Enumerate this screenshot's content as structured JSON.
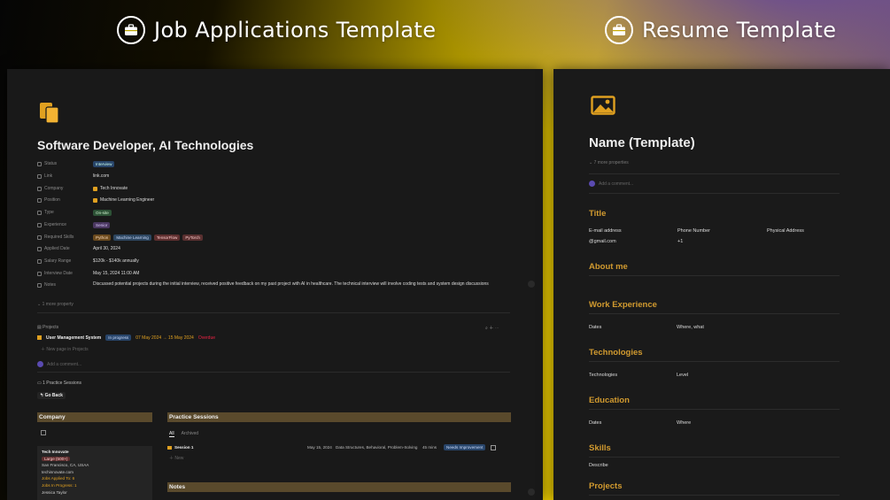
{
  "headers": {
    "left": "Job Applications Template",
    "right": "Resume Template"
  },
  "job": {
    "title": "Software Developer, AI Technologies",
    "props": [
      {
        "k": "Status",
        "v": "Interview"
      },
      {
        "k": "Link",
        "v": "link.com"
      },
      {
        "k": "Company",
        "v": "Tech Innovate"
      },
      {
        "k": "Position",
        "v": "Machine Learning Engineer"
      },
      {
        "k": "Type",
        "v": "On-site"
      },
      {
        "k": "Experience",
        "v": "Senior"
      },
      {
        "k": "Required Skills",
        "v": ""
      },
      {
        "k": "Applied Date",
        "v": "April 30, 2024"
      },
      {
        "k": "Salary Range",
        "v": "$120k - $140k annually"
      },
      {
        "k": "Interview Date",
        "v": "May 15, 2024 11:00 AM"
      },
      {
        "k": "Notes",
        "v": "Discussed potential projects during the initial interview, received positive feedback on my past project with AI in healthcare. The technical interview will involve coding tests and system design discussions"
      }
    ],
    "skills": [
      "Python",
      "Machine Learning",
      "TensorFlow",
      "PyTorch"
    ],
    "more": "1 more property",
    "projects_label": "Projects",
    "project": {
      "name": "User Management System",
      "status": "In progress",
      "dates": "07 May 2024 → 15 May 2024",
      "overdue": "Overdue"
    },
    "new_page": "New page in Projects",
    "comment": "Add a comment...",
    "practice_count": "1 Practice Sessions",
    "go_back": "Go Back",
    "company_section": "Company",
    "practice_section": "Practice Sessions",
    "notes_section": "Notes",
    "tabs": [
      "All",
      "Archived"
    ],
    "session": {
      "name": "Session 1",
      "date": "May 15, 2024",
      "topics": "Data Structures, Behavioral, Problem-Solving",
      "mins": "45 mins",
      "tag": "Needs Improvement"
    },
    "new": "New",
    "company_card": {
      "name": "Tech Innovate",
      "size": "Large (500+)",
      "location": "San Francisco, CA, USAA",
      "site": "techinnovate.com",
      "applied": "Jobs Applied To: 6",
      "inprog": "Jobs In Progress: 1",
      "contact": "Jessica Taylor"
    }
  },
  "resume": {
    "title": "Name (Template)",
    "more": "7 more properties",
    "comment": "Add a comment...",
    "sections": [
      {
        "h": "Title",
        "cols": [
          [
            "E-mail address",
            "@gmail.com"
          ],
          [
            "Phone Number",
            "+1"
          ],
          [
            "Physical Address",
            ""
          ]
        ]
      },
      {
        "h": "About me",
        "cols": []
      },
      {
        "h": "Work Experience",
        "cols": [
          [
            "Dates",
            ""
          ],
          [
            "Where, what",
            ""
          ]
        ]
      },
      {
        "h": "Technologies",
        "cols": [
          [
            "Technologies",
            ""
          ],
          [
            "Level",
            ""
          ]
        ]
      },
      {
        "h": "Education",
        "cols": [
          [
            "Dates",
            ""
          ],
          [
            "Where",
            ""
          ]
        ]
      },
      {
        "h": "Skills",
        "cols": [
          [
            "Describe",
            ""
          ]
        ]
      },
      {
        "h": "Projects",
        "cols": []
      }
    ]
  }
}
